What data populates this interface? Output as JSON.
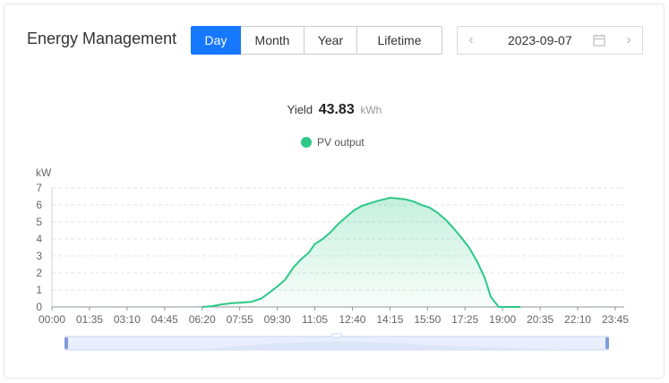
{
  "header": {
    "title": "Energy Management"
  },
  "tabs": [
    {
      "label": "Day",
      "active": true
    },
    {
      "label": "Month",
      "active": false
    },
    {
      "label": "Year",
      "active": false
    },
    {
      "label": "Lifetime",
      "active": false
    }
  ],
  "date_picker": {
    "value": "2023-09-07",
    "prev_icon": "chevron-left-icon",
    "next_icon": "chevron-right-icon",
    "calendar_icon": "calendar-icon"
  },
  "summary": {
    "label": "Yield",
    "value": "43.83",
    "unit": "kWh"
  },
  "colors": {
    "accent": "#1677ff",
    "series": "#2ec887"
  },
  "chart_data": {
    "type": "area",
    "ylabel": "kW",
    "ylim": [
      0,
      7
    ],
    "yticks": [
      "0",
      "1",
      "2",
      "3",
      "4",
      "5",
      "6",
      "7"
    ],
    "xticks": [
      "00:00",
      "01:35",
      "03:10",
      "04:45",
      "06:20",
      "07:55",
      "09:30",
      "11:05",
      "12:40",
      "14:15",
      "15:50",
      "17:25",
      "19:00",
      "20:35",
      "22:10",
      "23:45"
    ],
    "grid": true,
    "legend": "top-center",
    "series": [
      {
        "name": "PV output",
        "points": [
          [
            "06:20",
            0
          ],
          [
            "06:45",
            0.05
          ],
          [
            "07:10",
            0.15
          ],
          [
            "07:35",
            0.22
          ],
          [
            "08:00",
            0.26
          ],
          [
            "08:25",
            0.3
          ],
          [
            "08:50",
            0.5
          ],
          [
            "09:10",
            0.85
          ],
          [
            "09:30",
            1.2
          ],
          [
            "09:50",
            1.6
          ],
          [
            "10:10",
            2.3
          ],
          [
            "10:30",
            2.8
          ],
          [
            "10:50",
            3.2
          ],
          [
            "11:05",
            3.7
          ],
          [
            "11:25",
            4.0
          ],
          [
            "11:45",
            4.4
          ],
          [
            "12:05",
            4.9
          ],
          [
            "12:25",
            5.3
          ],
          [
            "12:45",
            5.7
          ],
          [
            "13:05",
            5.95
          ],
          [
            "13:25",
            6.1
          ],
          [
            "13:45",
            6.25
          ],
          [
            "14:05",
            6.35
          ],
          [
            "14:15",
            6.42
          ],
          [
            "14:35",
            6.38
          ],
          [
            "14:55",
            6.32
          ],
          [
            "15:15",
            6.2
          ],
          [
            "15:35",
            6.0
          ],
          [
            "15:55",
            5.85
          ],
          [
            "16:15",
            5.55
          ],
          [
            "16:35",
            5.15
          ],
          [
            "16:55",
            4.65
          ],
          [
            "17:15",
            4.1
          ],
          [
            "17:35",
            3.5
          ],
          [
            "17:55",
            2.7
          ],
          [
            "18:15",
            1.7
          ],
          [
            "18:30",
            0.6
          ],
          [
            "18:50",
            0.0
          ],
          [
            "19:45",
            0.0
          ]
        ]
      }
    ]
  }
}
